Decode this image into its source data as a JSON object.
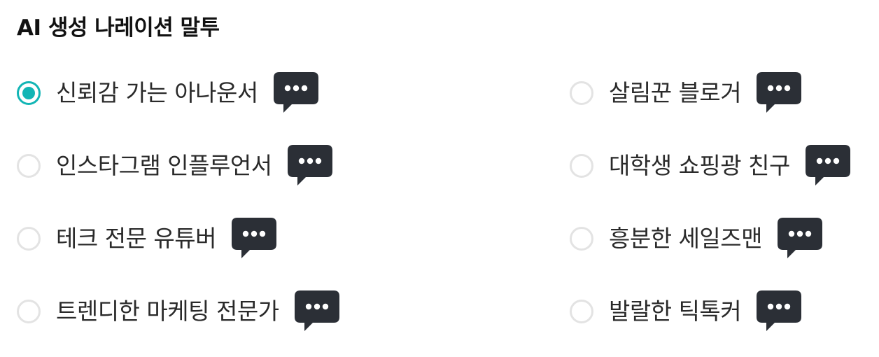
{
  "section": {
    "title": "AI 생성 나레이션 말투"
  },
  "colors": {
    "accent": "#12b5b5",
    "radio_border": "#e3e3e3",
    "bubble": "#2b2f36"
  },
  "icons": {
    "radio": "radio-button-icon",
    "sample": "speech-bubble-ellipsis-icon"
  },
  "voices": {
    "left": [
      {
        "label": "신뢰감 가는 아나운서",
        "selected": true
      },
      {
        "label": "인스타그램 인플루언서",
        "selected": false
      },
      {
        "label": "테크 전문 유튜버",
        "selected": false
      },
      {
        "label": "트렌디한 마케팅 전문가",
        "selected": false
      }
    ],
    "right": [
      {
        "label": "살림꾼 블로거",
        "selected": false
      },
      {
        "label": "대학생 쇼핑광 친구",
        "selected": false
      },
      {
        "label": "흥분한 세일즈맨",
        "selected": false
      },
      {
        "label": "발랄한 틱톡커",
        "selected": false
      }
    ]
  }
}
